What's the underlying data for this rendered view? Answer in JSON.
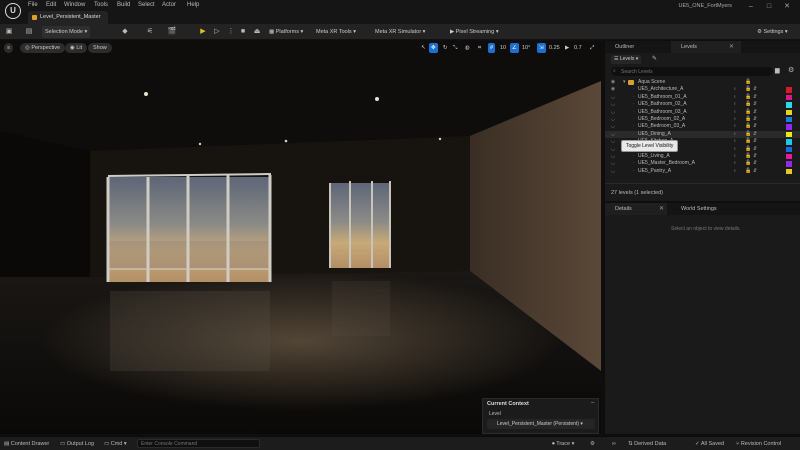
{
  "window": {
    "menu": [
      "File",
      "Edit",
      "Window",
      "Tools",
      "Build",
      "Select",
      "Actor",
      "Help"
    ],
    "doc_tab": "Level_Persistent_Master",
    "project": "UE5_ONE_FortMyers"
  },
  "toolbar": {
    "selection_mode": "Selection Mode",
    "platforms": "Platforms",
    "meta_xr_tools": "Meta XR Tools",
    "meta_xr_simulator": "Meta XR Simulator",
    "pixel_streaming": "Pixel Streaming",
    "settings": "Settings"
  },
  "viewport": {
    "perspective": "Perspective",
    "lit": "Lit",
    "show": "Show",
    "grid_snap": "10",
    "rot_snap": "10°",
    "scale_snap": "0.25",
    "cam_speed": "0.7",
    "context": {
      "header": "Current Context",
      "level_label": "Level",
      "level_value": "Level_Persistent_Master (Persistent)"
    }
  },
  "outliner": {
    "tab_outliner": "Outliner",
    "tab_levels": "Levels",
    "levels_dropdown": "Levels",
    "search_placeholder": "Search Levels",
    "group": "Aqua Scene",
    "rows": [
      {
        "name": "UE5_Architecture_A",
        "color": "#d8182f"
      },
      {
        "name": "UE5_Bathroom_01_A",
        "color": "#d81887"
      },
      {
        "name": "UE5_Bathroom_02_A",
        "color": "#2bd8e8"
      },
      {
        "name": "UE5_Bathroom_03_A",
        "color": "#e8d21a"
      },
      {
        "name": "UE5_Bedroom_02_A",
        "color": "#1a7ee8"
      },
      {
        "name": "UE5_Bedroom_03_A",
        "color": "#8e2ae8"
      },
      {
        "name": "UE5_Dining_A",
        "color": "#e8e81a"
      },
      {
        "name": "UE5_Kitchen_A",
        "color": "#18c8e8"
      },
      {
        "name": "UE5_Laundry_A",
        "color": "#1a6ae8"
      },
      {
        "name": "UE5_Living_A",
        "color": "#e8189a"
      },
      {
        "name": "UE5_Master_Bedroom_A",
        "color": "#8e2ae8"
      },
      {
        "name": "UE5_Pantry_A",
        "color": "#e8c81a"
      }
    ],
    "tooltip": "Toggle Level Visibility",
    "count": "27 levels (1 selected)"
  },
  "details": {
    "tab_details": "Details",
    "tab_world": "World Settings",
    "empty": "Select an object to view details."
  },
  "status": {
    "content_drawer": "Content Drawer",
    "output_log": "Output Log",
    "cmd": "Cmd",
    "console_placeholder": "Enter Console Command",
    "trace": "Trace",
    "derived": "Derived Data",
    "saved": "All Saved",
    "revision": "Revision Control"
  }
}
